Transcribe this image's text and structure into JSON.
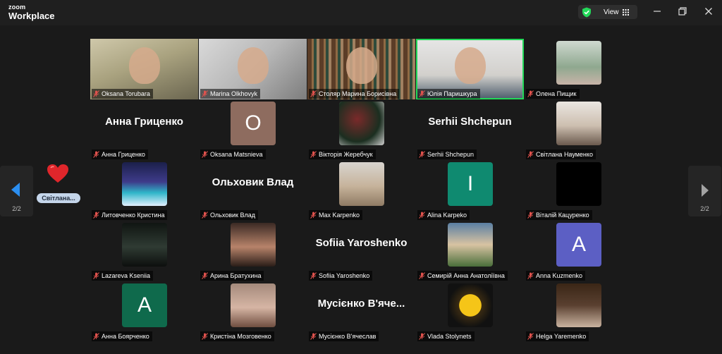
{
  "app": {
    "brand_top": "zoom",
    "brand_bottom": "Workplace"
  },
  "toolbar": {
    "view_label": "View"
  },
  "pagination": {
    "left": "2/2",
    "right": "2/2"
  },
  "reaction_name": "Світлана...",
  "colors": {
    "active_speaker": "#23d959",
    "shield": "#23d959",
    "muted_mic": "#e0524d"
  },
  "tiles": [
    {
      "label": "Oksana Torubara",
      "kind": "video"
    },
    {
      "label": "Marina Olkhovyk",
      "kind": "video"
    },
    {
      "label": "Столяр Марина Борисівна",
      "kind": "video"
    },
    {
      "label": "Юлія Паришкура",
      "kind": "video",
      "active": true
    },
    {
      "label": "Олена Пищик",
      "kind": "thumb"
    },
    {
      "label": "Анна Гриценко",
      "kind": "name",
      "display": "Анна Гриценко"
    },
    {
      "label": "Oksana Matsnieva",
      "kind": "avatar",
      "initial": "O",
      "color": "#8e6c5f"
    },
    {
      "label": "Вікторія Жеребчук",
      "kind": "thumb"
    },
    {
      "label": "Serhii Shchepun",
      "kind": "name",
      "display": "Serhii Shchepun"
    },
    {
      "label": "Світлана Науменко",
      "kind": "thumb"
    },
    {
      "label": "Литовченко Кристина",
      "kind": "thumb"
    },
    {
      "label": "Ольховик Влад",
      "kind": "name",
      "display": "Ольховик Влад"
    },
    {
      "label": "Max Karpenko",
      "kind": "thumb"
    },
    {
      "label": "Alina Karpeko",
      "kind": "avatar",
      "initial": "I",
      "color": "#0f8a70"
    },
    {
      "label": "Віталій Кацуренко",
      "kind": "thumb"
    },
    {
      "label": "Lazareva Kseniia",
      "kind": "thumb"
    },
    {
      "label": "Арина Братухина",
      "kind": "thumb"
    },
    {
      "label": "Sofiia Yaroshenko",
      "kind": "name",
      "display": "Sofiia Yaroshenko"
    },
    {
      "label": "Семирій Анна Анатоліївна",
      "kind": "thumb"
    },
    {
      "label": "Anna Kuzmenko",
      "kind": "avatar",
      "initial": "A",
      "color": "#5c5fc4"
    },
    {
      "label": "Анна Боярченко",
      "kind": "avatar",
      "initial": "A",
      "color": "#0f6a4c"
    },
    {
      "label": "Кристіна Мозговенко",
      "kind": "thumb"
    },
    {
      "label": "Мусієнко В'ячеслав",
      "kind": "name",
      "display": "Мусієнко В'яче..."
    },
    {
      "label": "Vlada Stolynets",
      "kind": "thumb"
    },
    {
      "label": "Helga Yaremenko",
      "kind": "thumb"
    }
  ]
}
